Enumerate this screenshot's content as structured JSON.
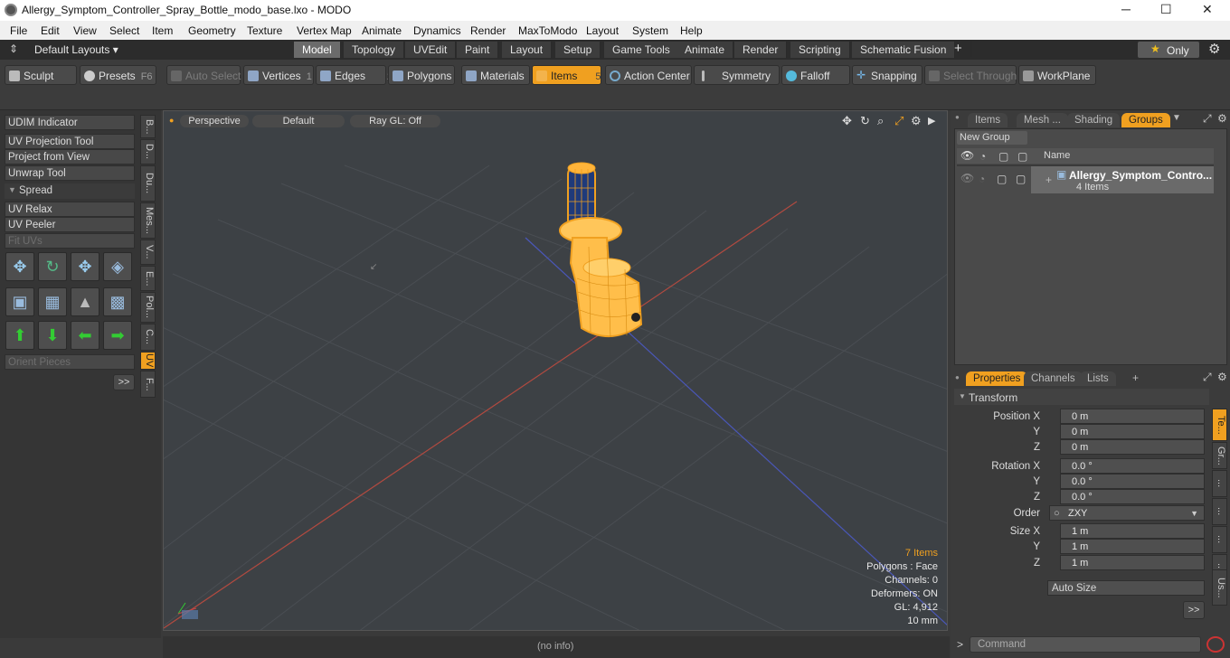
{
  "window": {
    "title": "Allergy_Symptom_Controller_Spray_Bottle_modo_base.lxo - MODO",
    "minimize": "─",
    "maximize": "☐",
    "close": "✕"
  },
  "menu": [
    "File",
    "Edit",
    "View",
    "Select",
    "Item",
    "Geometry",
    "Texture",
    "Vertex Map",
    "Animate",
    "Dynamics",
    "Render",
    "MaxToModo",
    "Layout",
    "System",
    "Help"
  ],
  "layouts": {
    "label": "Default Layouts ▾"
  },
  "tabs": [
    "Model",
    "Topology",
    "UVEdit",
    "Paint",
    "Layout",
    "Setup",
    "Game Tools",
    "Animate",
    "Render",
    "Scripting",
    "Schematic Fusion",
    "+"
  ],
  "only": {
    "label": "Only"
  },
  "toolbar": {
    "sculpt": "Sculpt",
    "presets": "Presets",
    "presets_key": "F6",
    "auto_select": "Auto Select",
    "vertices": "Vertices",
    "vertices_key": "1",
    "edges": "Edges",
    "edges_key": "2",
    "polygons": "Polygons",
    "materials": "Materials",
    "items": "Items",
    "items_key": "5",
    "action_center": "Action Center",
    "symmetry": "Symmetry",
    "falloff": "Falloff",
    "snapping": "Snapping",
    "select_through": "Select Through",
    "workplane": "WorkPlane"
  },
  "left": {
    "udim": "UDIM Indicator",
    "uv_projection": "UV Projection Tool",
    "project_view": "Project from View",
    "unwrap": "Unwrap Tool",
    "spread": "Spread",
    "uv_relax": "UV Relax",
    "uv_peeler": "UV Peeler",
    "fit_uvs": "Fit UVs",
    "orient": "Orient Pieces",
    "more": ">>",
    "vtabs": [
      "B...",
      "D...",
      "Du...",
      "Mes...",
      "V...",
      "E...",
      "Pol...",
      "C...",
      "UV",
      "F..."
    ]
  },
  "viewport": {
    "perspective": "Perspective",
    "default": "Default",
    "raygl": "Ray GL: Off",
    "info": {
      "items": "7 Items",
      "polygons": "Polygons : Face",
      "channels": "Channels: 0",
      "deformers": "Deformers: ON",
      "gl": "GL: 4,912",
      "unit": "10 mm"
    }
  },
  "status": {
    "text": "(no info)"
  },
  "groups": {
    "tabs": [
      "Items",
      "Mesh ...",
      "Shading",
      "Groups"
    ],
    "new_group": "New Group",
    "col_name": "Name",
    "item_name": "Allergy_Symptom_Contro...",
    "item_count": "4 Items"
  },
  "properties": {
    "tabs": [
      "Properties",
      "Channels",
      "Lists",
      "+"
    ],
    "transform": "Transform",
    "pos_x_label": "Position X",
    "y_label": "Y",
    "z_label": "Z",
    "pos_x": "0 m",
    "pos_y": "0 m",
    "pos_z": "0 m",
    "rot_x_label": "Rotation X",
    "rot_x": "0.0 °",
    "rot_y": "0.0 °",
    "rot_z": "0.0 °",
    "order_label": "Order",
    "order": "ZXY",
    "size_x_label": "Size X",
    "size_x": "1 m",
    "size_y": "1 m",
    "size_z": "1 m",
    "auto_size": "Auto Size",
    "more": ">>",
    "side_tabs": [
      "Te...",
      "Gr...",
      "...",
      "...",
      "...",
      "...",
      "Us..."
    ]
  },
  "command": {
    "placeholder": "Command"
  },
  "colors": {
    "accent": "#f0a020",
    "viewport_bg": "#3d4145"
  }
}
